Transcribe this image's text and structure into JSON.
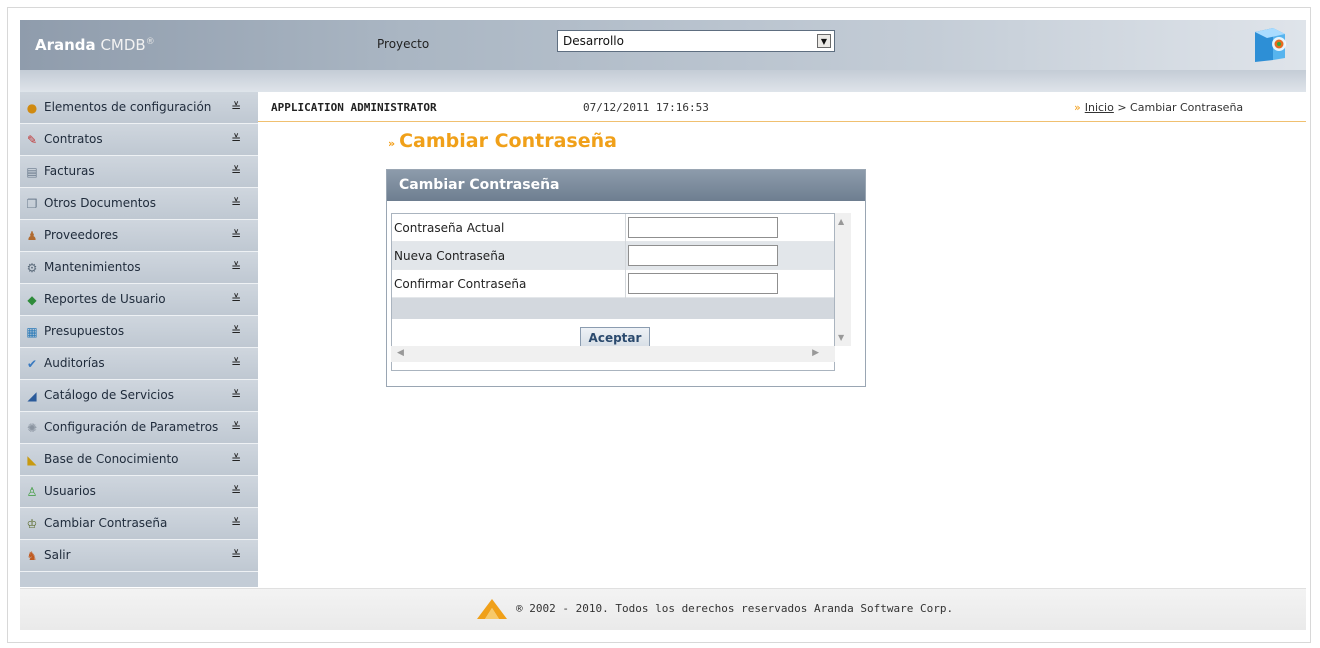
{
  "header": {
    "logo_bold": "Aranda",
    "logo_rest": "CMDB",
    "logo_reg": "®",
    "project_label": "Proyecto",
    "project_selected": "Desarrollo"
  },
  "sidebar": {
    "items": [
      {
        "label": "Elementos de configuración",
        "icon": "config-elements-icon"
      },
      {
        "label": "Contratos",
        "icon": "contracts-icon"
      },
      {
        "label": "Facturas",
        "icon": "invoices-icon"
      },
      {
        "label": "Otros Documentos",
        "icon": "documents-icon"
      },
      {
        "label": "Proveedores",
        "icon": "suppliers-icon"
      },
      {
        "label": "Mantenimientos",
        "icon": "maintenance-icon"
      },
      {
        "label": "Reportes de Usuario",
        "icon": "reports-icon"
      },
      {
        "label": "Presupuestos",
        "icon": "budgets-icon"
      },
      {
        "label": "Auditorías",
        "icon": "audits-icon"
      },
      {
        "label": "Catálogo de Servicios",
        "icon": "services-catalog-icon"
      },
      {
        "label": "Configuración de Parametros",
        "icon": "gear-icon"
      },
      {
        "label": "Base de Conocimiento",
        "icon": "knowledge-base-icon"
      },
      {
        "label": "Usuarios",
        "icon": "users-icon"
      },
      {
        "label": "Cambiar Contraseña",
        "icon": "change-password-icon"
      },
      {
        "label": "Salir",
        "icon": "exit-icon"
      }
    ]
  },
  "topbar": {
    "user": "APPLICATION ADMINISTRATOR",
    "datetime": "07/12/2011 17:16:53",
    "breadcrumb_home": "Inicio",
    "breadcrumb_current": "> Cambiar Contraseña"
  },
  "page": {
    "title": "Cambiar Contraseña"
  },
  "form": {
    "panel_title": "Cambiar Contraseña",
    "current_label": "Contraseña Actual",
    "new_label": "Nueva Contraseña",
    "confirm_label": "Confirmar Contraseña",
    "current_value": "",
    "new_value": "",
    "confirm_value": "",
    "submit_label": "Aceptar"
  },
  "footer": {
    "text": "® 2002 - 2010. Todos los derechos reservados Aranda Software Corp."
  },
  "colors": {
    "accent": "#f0a019",
    "header_gray": "#8f9cac",
    "panel_head": "#7a8a9c"
  }
}
